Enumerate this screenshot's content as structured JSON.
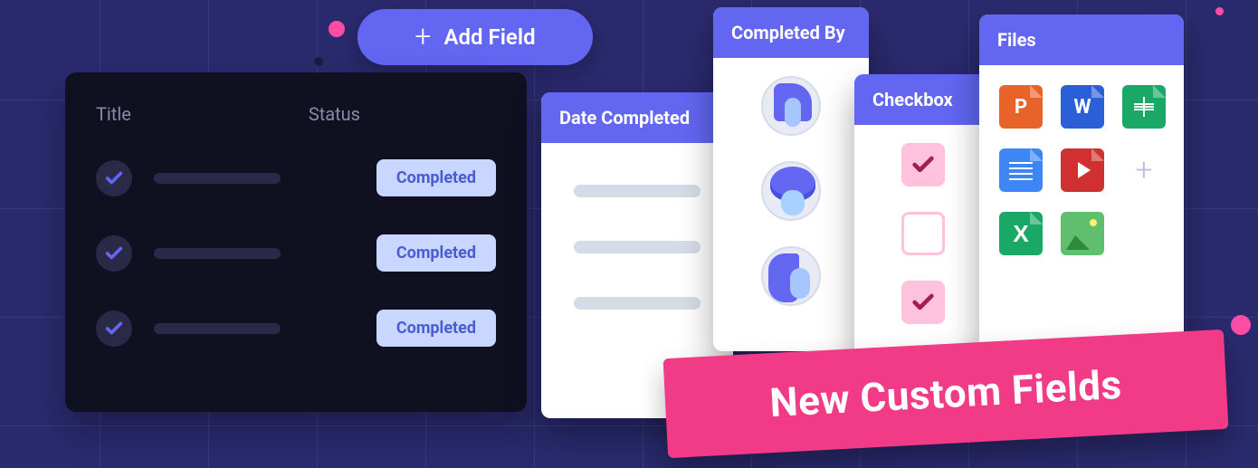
{
  "add_button": {
    "label": "Add Field"
  },
  "task_panel": {
    "columns": {
      "title": "Title",
      "status": "Status"
    },
    "status_label": "Completed",
    "rows": [
      {
        "checked": true,
        "status": "Completed"
      },
      {
        "checked": true,
        "status": "Completed"
      },
      {
        "checked": true,
        "status": "Completed"
      }
    ]
  },
  "cards": {
    "date": {
      "title": "Date Completed"
    },
    "users": {
      "title": "Completed By"
    },
    "checkbox": {
      "title": "Checkbox",
      "items": [
        {
          "checked": true
        },
        {
          "checked": false
        },
        {
          "checked": true
        }
      ]
    },
    "files": {
      "title": "Files",
      "items": [
        {
          "name": "powerpoint",
          "letter": "P"
        },
        {
          "name": "word",
          "letter": "W"
        },
        {
          "name": "sheets"
        },
        {
          "name": "docs"
        },
        {
          "name": "video"
        },
        {
          "name": "add"
        },
        {
          "name": "excel",
          "letter": "X"
        },
        {
          "name": "image"
        }
      ]
    }
  },
  "banner": {
    "text": "New Custom Fields"
  }
}
